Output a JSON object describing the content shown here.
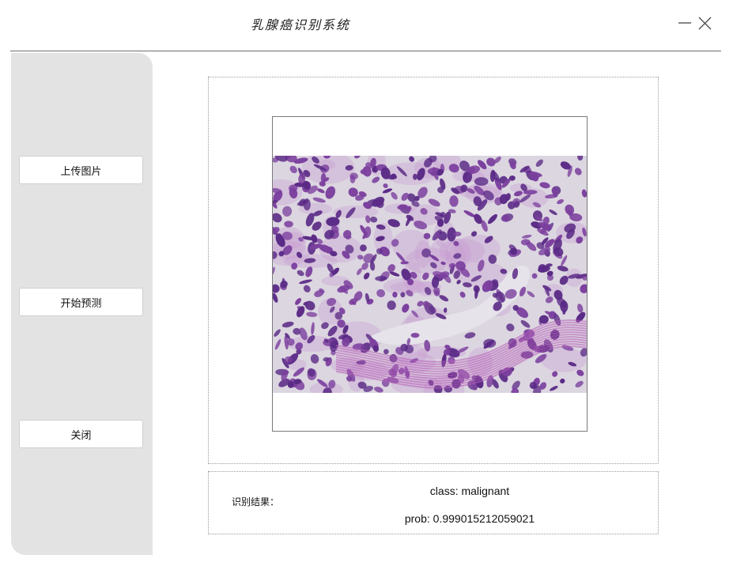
{
  "app": {
    "title": "乳腺癌识别系统"
  },
  "window_controls": {
    "minimize_icon": "minimize-icon",
    "close_icon": "close-icon"
  },
  "sidebar": {
    "buttons": [
      {
        "label": "上传图片"
      },
      {
        "label": "开始预测"
      },
      {
        "label": "关闭"
      }
    ]
  },
  "image_panel": {
    "image_description_icon": "histopathology-image"
  },
  "result": {
    "label": "识别结果：",
    "class_text": "class: malignant",
    "prob_text": "prob: 0.999015212059021"
  },
  "colors": {
    "sidebar_bg": "#e3e3e3",
    "divider": "#6e6e6e",
    "tissue_bg": "#dcd6e0",
    "cell_dark": "#5a2a86",
    "cell_mid": "#7b3f9e",
    "stroma": "#b65fb8"
  }
}
